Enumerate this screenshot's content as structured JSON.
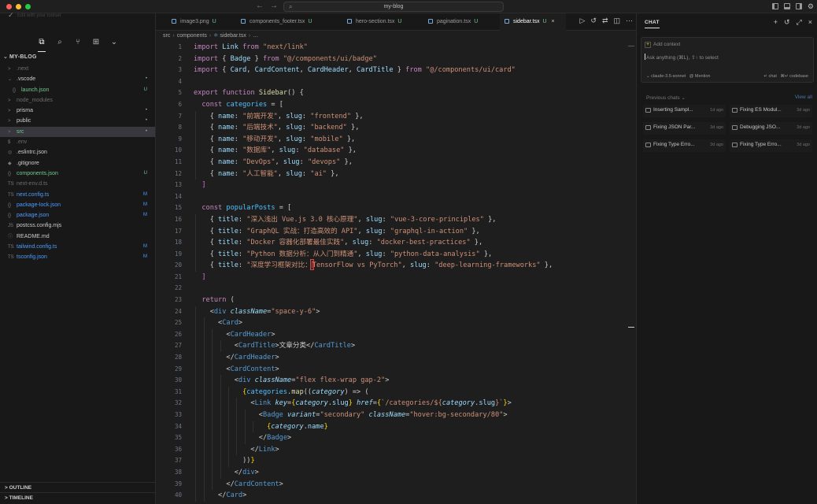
{
  "titlebar": {
    "title": "my-blog",
    "back": "←",
    "forward": "→",
    "search_icon": "search-icon"
  },
  "sidebar": {
    "top_hint": "Edit with your toolset",
    "project": "MY-BLOG",
    "files": [
      {
        "name": ".next",
        "icon": ">",
        "status": "",
        "color": "dim"
      },
      {
        "name": ".vscode",
        "icon": "⌄",
        "status": "•",
        "color": "def"
      },
      {
        "name": "launch.json",
        "icon": "{}",
        "status": "U",
        "color": "new",
        "indent": true
      },
      {
        "name": "node_modules",
        "icon": ">",
        "status": "",
        "color": "dim"
      },
      {
        "name": "prisma",
        "icon": ">",
        "status": "•",
        "color": "def"
      },
      {
        "name": "public",
        "icon": ">",
        "status": "•",
        "color": "def"
      },
      {
        "name": "src",
        "icon": ">",
        "status": "•",
        "color": "new",
        "selected": true
      },
      {
        "name": ".env",
        "icon": "$",
        "status": "",
        "color": "dim"
      },
      {
        "name": ".eslintrc.json",
        "icon": "◎",
        "status": "",
        "color": "def"
      },
      {
        "name": ".gitignore",
        "icon": "◆",
        "status": "",
        "color": "def"
      },
      {
        "name": "components.json",
        "icon": "{}",
        "status": "U",
        "color": "new"
      },
      {
        "name": "next-env.d.ts",
        "icon": "TS",
        "status": "",
        "color": "dim"
      },
      {
        "name": "next.config.ts",
        "icon": "TS",
        "status": "M",
        "color": "mod"
      },
      {
        "name": "package-lock.json",
        "icon": "{}",
        "status": "M",
        "color": "mod"
      },
      {
        "name": "package.json",
        "icon": "{}",
        "status": "M",
        "color": "mod"
      },
      {
        "name": "postcss.config.mjs",
        "icon": "JS",
        "status": "",
        "color": "def"
      },
      {
        "name": "README.md",
        "icon": "ⓘ",
        "status": "",
        "color": "def"
      },
      {
        "name": "tailwind.config.ts",
        "icon": "TS",
        "status": "M",
        "color": "mod"
      },
      {
        "name": "tsconfig.json",
        "icon": "TS",
        "status": "M",
        "color": "mod"
      }
    ],
    "outline": "OUTLINE",
    "timeline": "TIMELINE"
  },
  "tabs": [
    {
      "label": "image3.png",
      "status": "U",
      "active": false
    },
    {
      "label": "components_footer.tsx",
      "status": "U",
      "active": false
    },
    {
      "label": "hero-section.tsx",
      "status": "U",
      "active": false
    },
    {
      "label": "pagination.tsx",
      "status": "U",
      "active": false
    },
    {
      "label": "sidebar.tsx",
      "status": "U",
      "active": true
    }
  ],
  "breadcrumb": [
    "src",
    "components",
    "sidebar.tsx",
    "…"
  ],
  "code": [
    {
      "n": "1",
      "html": "<span class='k'>import</span> <span class='v'>Link</span> <span class='k'>from</span> <span class='s'>\"next/link\"</span>"
    },
    {
      "n": "2",
      "html": "<span class='k'>import</span> { <span class='v'>Badge</span> } <span class='k'>from</span> <span class='s'>\"@/components/ui/badge\"</span>"
    },
    {
      "n": "3",
      "html": "<span class='k'>import</span> { <span class='v'>Card</span>, <span class='v'>CardContent</span>, <span class='v'>CardHeader</span>, <span class='v'>CardTitle</span> } <span class='k'>from</span> <span class='s'>\"@/components/ui/card\"</span>"
    },
    {
      "n": "4",
      "html": ""
    },
    {
      "n": "5",
      "html": "<span class='k'>export</span> <span class='k'>function</span> <span class='f'>Sidebar</span>() {"
    },
    {
      "n": "6",
      "html": "  <span class='k'>const</span> <span class='c'>categories</span> = ["
    },
    {
      "n": "7",
      "html": "    { <span class='v'>name</span>: <span class='s'>\"前端开发\"</span>, <span class='v'>slug</span>: <span class='s'>\"frontend\"</span> },"
    },
    {
      "n": "8",
      "html": "    { <span class='v'>name</span>: <span class='s'>\"后端技术\"</span>, <span class='v'>slug</span>: <span class='s'>\"backend\"</span> },"
    },
    {
      "n": "9",
      "html": "    { <span class='v'>name</span>: <span class='s'>\"移动开发\"</span>, <span class='v'>slug</span>: <span class='s'>\"mobile\"</span> },"
    },
    {
      "n": "10",
      "html": "    { <span class='v'>name</span>: <span class='s'>\"数据库\"</span>, <span class='v'>slug</span>: <span class='s'>\"database\"</span> },"
    },
    {
      "n": "11",
      "html": "    { <span class='v'>name</span>: <span class='s'>\"DevOps\"</span>, <span class='v'>slug</span>: <span class='s'>\"devops\"</span> },"
    },
    {
      "n": "12",
      "html": "    { <span class='v'>name</span>: <span class='s'>\"人工智能\"</span>, <span class='v'>slug</span>: <span class='s'>\"ai\"</span> },"
    },
    {
      "n": "13",
      "html": "  <span class='p'>]</span>"
    },
    {
      "n": "14",
      "html": ""
    },
    {
      "n": "15",
      "html": "  <span class='k'>const</span> <span class='c'>popularPosts</span> = ["
    },
    {
      "n": "16",
      "html": "    { <span class='v'>title</span>: <span class='s'>\"深入浅出 Vue.js 3.0 核心原理\"</span>, <span class='v'>slug</span>: <span class='s'>\"vue-3-core-principles\"</span> },"
    },
    {
      "n": "17",
      "html": "    { <span class='v'>title</span>: <span class='s'>\"GraphQL 实战：打造高效的 API\"</span>, <span class='v'>slug</span>: <span class='s'>\"graphql-in-action\"</span> },"
    },
    {
      "n": "18",
      "html": "    { <span class='v'>title</span>: <span class='s'>\"Docker 容器化部署最佳实践\"</span>, <span class='v'>slug</span>: <span class='s'>\"docker-best-practices\"</span> },"
    },
    {
      "n": "19",
      "html": "    { <span class='v'>title</span>: <span class='s'>\"Python 数据分析：从入门到精通\"</span>, <span class='v'>slug</span>: <span class='s'>\"python-data-analysis\"</span> },"
    },
    {
      "n": "20",
      "html": "    { <span class='v'>title</span>: <span class='s'>\"深度学习框架对比：<span class='cur'></span>TensorFlow vs PyTorch\"</span>, <span class='v'>slug</span>: <span class='s'>\"deep-learning-frameworks\"</span> },"
    },
    {
      "n": "21",
      "html": "  <span class='p'>]</span>"
    },
    {
      "n": "22",
      "html": ""
    },
    {
      "n": "23",
      "html": "  <span class='k'>return</span> ("
    },
    {
      "n": "24",
      "html": "    &lt;<span class='t'>div</span> <span class='a'>className</span>=<span class='s'>\"space-y-6\"</span>&gt;"
    },
    {
      "n": "25",
      "html": "      &lt;<span class='t'>Card</span>&gt;"
    },
    {
      "n": "26",
      "html": "        &lt;<span class='t'>CardHeader</span>&gt;"
    },
    {
      "n": "27",
      "html": "          &lt;<span class='t'>CardTitle</span>&gt;文章分类&lt;/<span class='t'>CardTitle</span>&gt;"
    },
    {
      "n": "28",
      "html": "        &lt;/<span class='t'>CardHeader</span>&gt;"
    },
    {
      "n": "29",
      "html": "        &lt;<span class='t'>CardContent</span>&gt;"
    },
    {
      "n": "30",
      "html": "          &lt;<span class='t'>div</span> <span class='a'>className</span>=<span class='s'>\"flex flex-wrap gap-2\"</span>&gt;"
    },
    {
      "n": "31",
      "html": "            <span class='b'>{</span><span class='c'>categories</span>.<span class='f'>map</span>((<span class='i'>category</span>) =&gt; ("
    },
    {
      "n": "32",
      "html": "              &lt;<span class='t'>Link</span> <span class='a'>key</span>=<span class='b'>{</span><span class='i'>category</span>.<span class='v'>slug</span><span class='b'>}</span> <span class='a'>href</span>=<span class='b'>{</span><span class='s'>`/categories/${</span><span class='i'>category</span>.<span class='v'>slug</span><span class='s'>}`</span><span class='b'>}</span>&gt;"
    },
    {
      "n": "33",
      "html": "                &lt;<span class='t'>Badge</span> <span class='a'>variant</span>=<span class='s'>\"secondary\"</span> <span class='a'>className</span>=<span class='s'>\"hover:bg-secondary/80\"</span>&gt;"
    },
    {
      "n": "34",
      "html": "                  <span class='b'>{</span><span class='i'>category</span>.<span class='v'>name</span><span class='b'>}</span>"
    },
    {
      "n": "35",
      "html": "                &lt;/<span class='t'>Badge</span>&gt;"
    },
    {
      "n": "36",
      "html": "              &lt;/<span class='t'>Link</span>&gt;"
    },
    {
      "n": "37",
      "html": "            ))<span class='b'>}</span>"
    },
    {
      "n": "38",
      "html": "          &lt;/<span class='t'>div</span>&gt;"
    },
    {
      "n": "39",
      "html": "        &lt;/<span class='t'>CardContent</span>&gt;"
    },
    {
      "n": "40",
      "html": "      &lt;/<span class='t'>Card</span>&gt;"
    }
  ],
  "chat": {
    "header": "CHAT",
    "add_context": "Add context",
    "placeholder": "Ask anything (⌘L), ⇧↑ to select",
    "model": "claude-3.5-sonnet",
    "mention": "@ Mention",
    "chat_hint": "↵ chat",
    "codebase_hint": "⌘↵ codebase",
    "previous": "Previous chats",
    "view_all": "View all",
    "previous_chats": [
      {
        "title": "Inserting Sampl...",
        "age": "1d ago"
      },
      {
        "title": "Fixing ES Modul...",
        "age": "3d ago"
      },
      {
        "title": "Fixing JSON Par...",
        "age": "3d ago"
      },
      {
        "title": "Debugging JSO...",
        "age": "3d ago"
      },
      {
        "title": "Fixing Type Erro...",
        "age": "3d ago"
      },
      {
        "title": "Fixing Type Erro...",
        "age": "3d ago"
      }
    ]
  },
  "colors": {
    "keyword": "#c586c0",
    "string": "#ce9178",
    "variable": "#9cdcfe",
    "const": "#4fc1ff",
    "function": "#dcdcaa",
    "tag": "#569cd6",
    "attr": "#9cdcfe",
    "modified": "#4d9cff",
    "untracked": "#73c991"
  }
}
